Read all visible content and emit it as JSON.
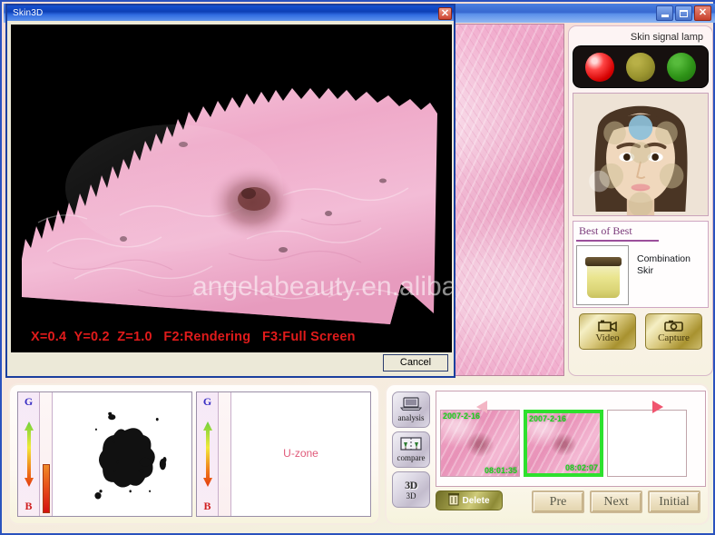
{
  "app_window": {
    "controls": [
      {
        "name": "minimize",
        "glyph": "_"
      },
      {
        "name": "maximize",
        "glyph": "□"
      },
      {
        "name": "close",
        "glyph": "✕"
      }
    ]
  },
  "dialog": {
    "title": "Skin3D",
    "close_glyph": "✕",
    "cancel_label": "Cancel",
    "hud": "X=0.4  Y=0.2  Z=1.0   F2:Rendering   F3:Full Screen",
    "hud_parts": {
      "x": "X=0.4",
      "y": "Y=0.2",
      "z": "Z=1.0",
      "f2": "F2:Rendering",
      "f3": "F3:Full Screen"
    },
    "hud_color": "#e01b1b",
    "canvas_background": "#000000"
  },
  "watermark": {
    "text": "angelabeauty.en.alibaba.com"
  },
  "sidebar": {
    "signal_lamp": {
      "title": "Skin signal lamp",
      "lamps": [
        {
          "name": "lamp-red",
          "state": "on",
          "color": "#ff2a2a"
        },
        {
          "name": "lamp-yellow",
          "state": "off",
          "color": "#9a942f"
        },
        {
          "name": "lamp-green",
          "state": "on",
          "color": "#2f9418"
        }
      ]
    },
    "face_map": {
      "selected_zone": "forehead-center",
      "selected_color": "#8cc0da",
      "zone_color": "#d6c9a4"
    },
    "best_of_best": {
      "title": "Best of Best",
      "product_name": "Combination Skir"
    },
    "media": {
      "video_label": "Video",
      "capture_label": "Capture"
    }
  },
  "analysis": {
    "panels": [
      {
        "name": "pigment-panel",
        "scale_top": "G",
        "scale_bottom": "B",
        "level_percent": 40,
        "caption": ""
      },
      {
        "name": "uzone-panel",
        "scale_top": "G",
        "scale_bottom": "B",
        "level_percent": 0,
        "caption": "U-zone"
      }
    ]
  },
  "tools": [
    {
      "name": "analysis",
      "label": "analysis",
      "icon": "laptop-icon"
    },
    {
      "name": "compare",
      "label": "compare",
      "icon": "compare-icon"
    },
    {
      "name": "3d",
      "label": "3D",
      "icon": "cube-3d-icon",
      "badge": "3D"
    }
  ],
  "thumbnails": {
    "prev_arrow": "◀",
    "next_arrow": "▶",
    "items": [
      {
        "name": "thumb-1",
        "date_top": "2007-2-16",
        "date_bottom": "08:01:35",
        "selected": false
      },
      {
        "name": "thumb-2",
        "date_top": "2007-2-16",
        "date_bottom": "08:02:07",
        "selected": true
      },
      {
        "name": "thumb-3",
        "date_top": "",
        "date_bottom": "",
        "selected": false,
        "blank": true
      }
    ]
  },
  "bottom_buttons": {
    "delete_label": "Delete",
    "pre_label": "Pre",
    "next_label": "Next",
    "initial_label": "Initial"
  }
}
